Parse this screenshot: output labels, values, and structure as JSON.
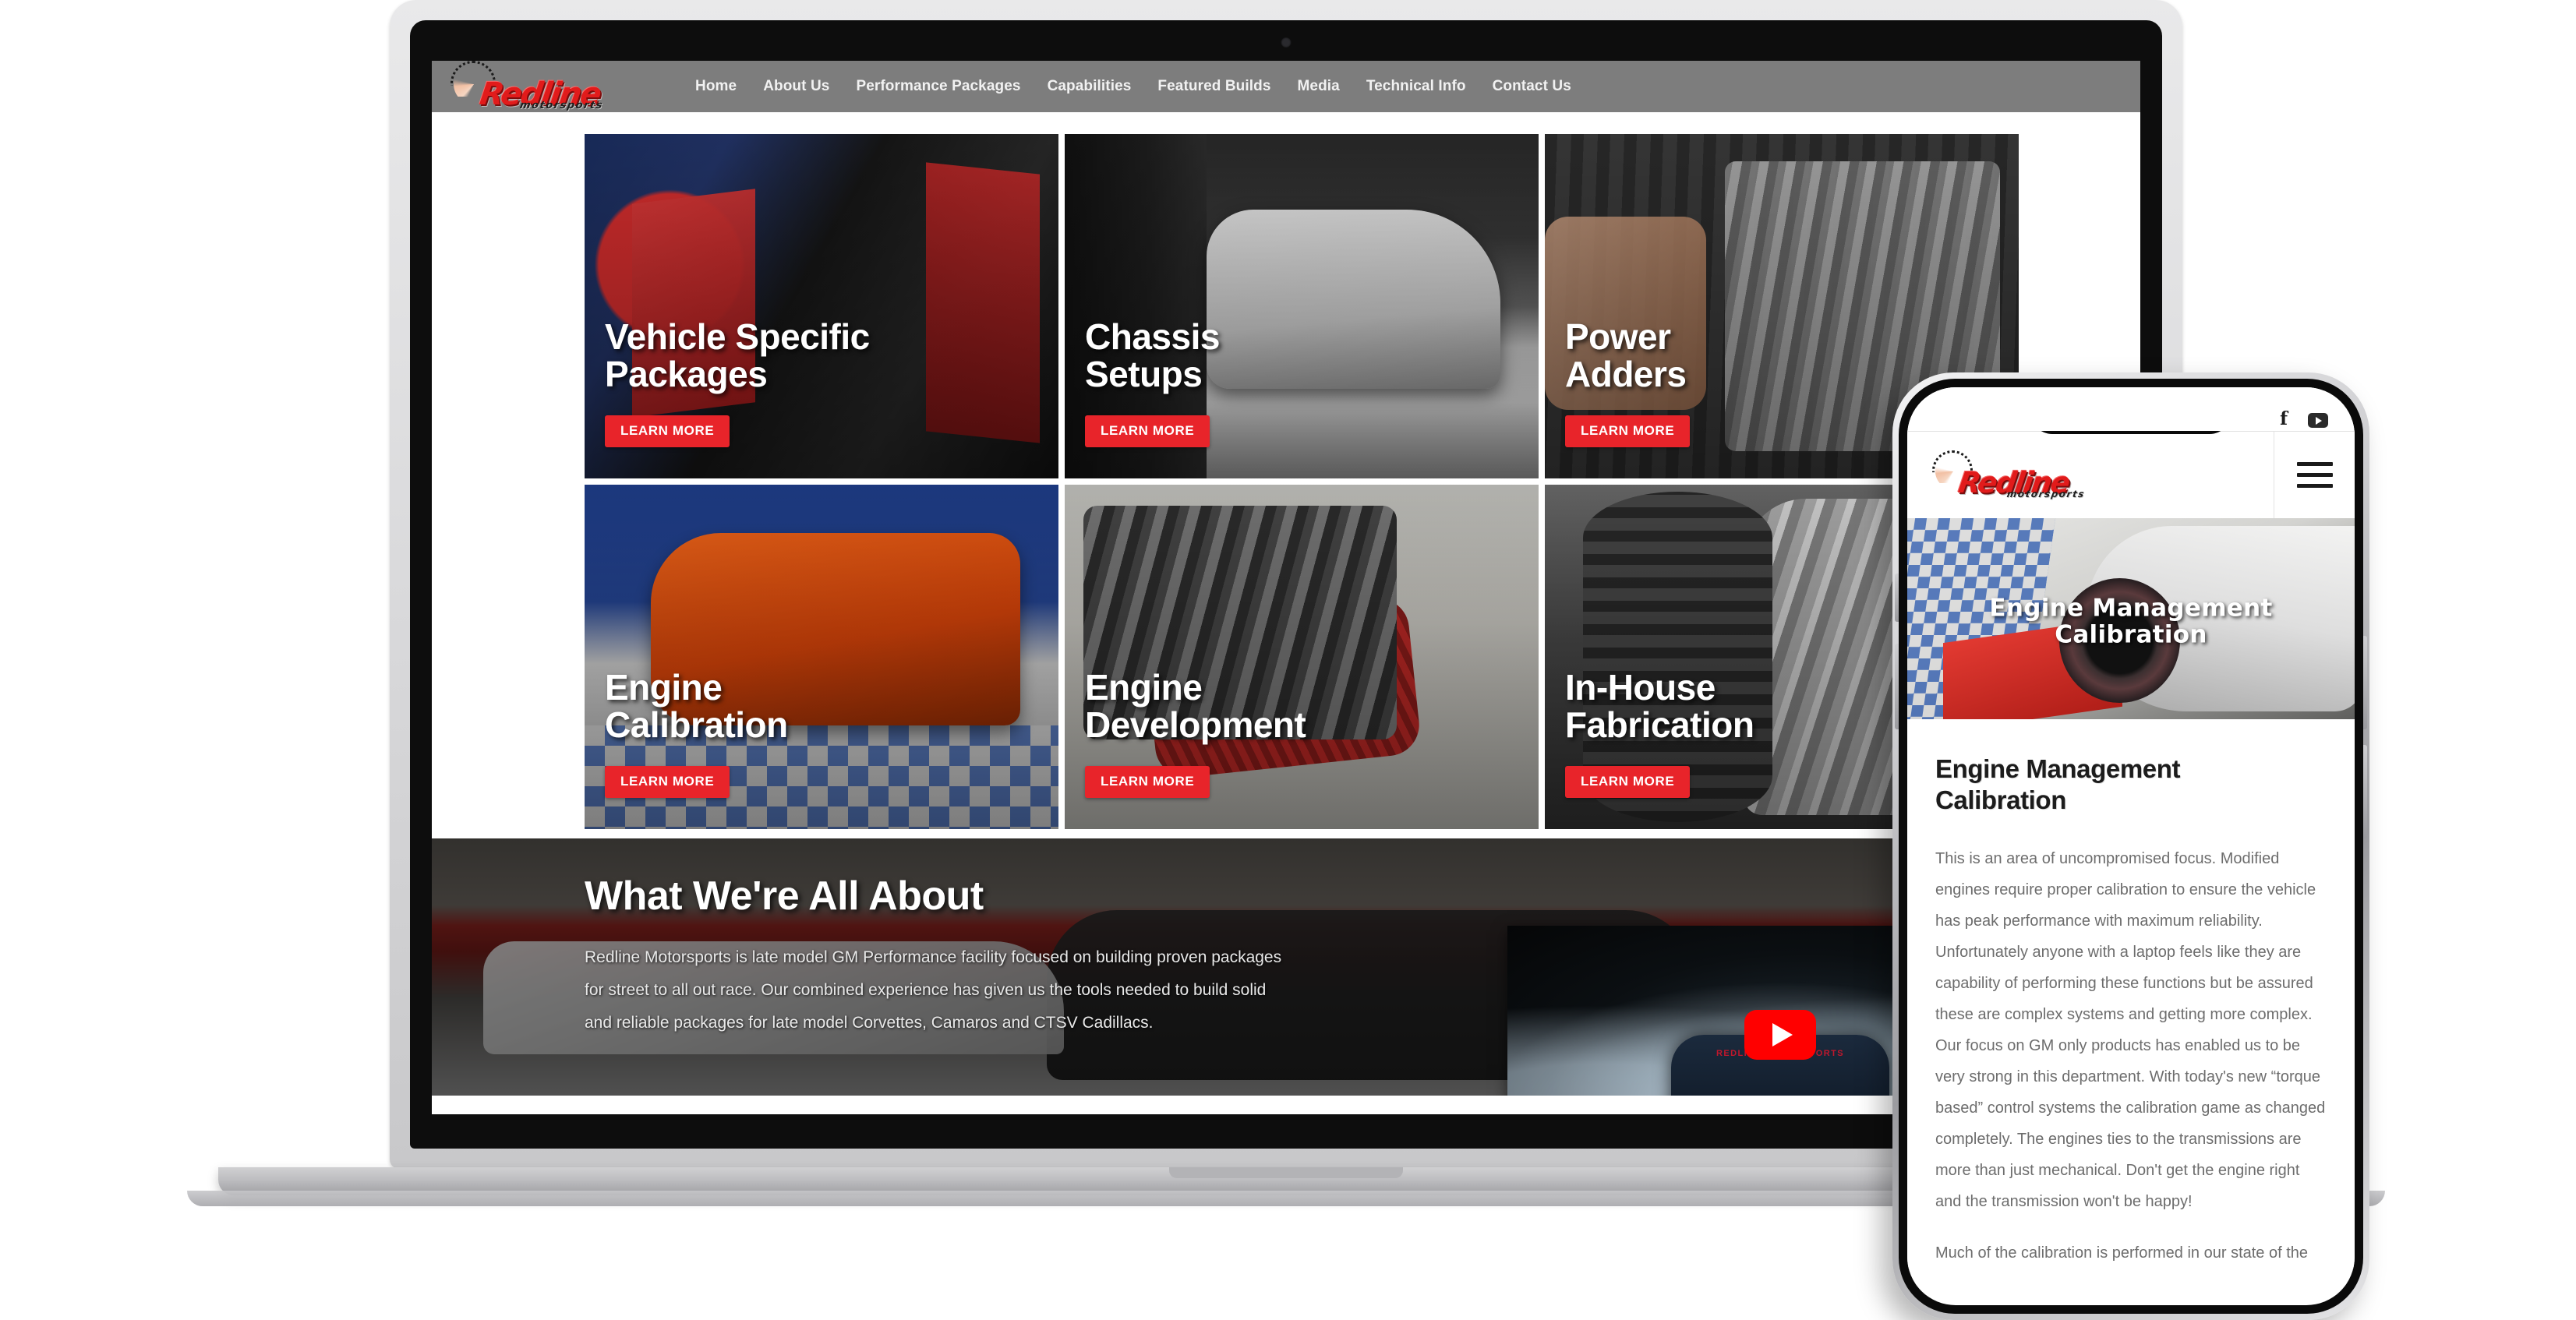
{
  "brand": {
    "name": "Redline",
    "tagline": "motorsports",
    "accent_red": "#e8242a",
    "nav_bar_gray": "#7d7d7d"
  },
  "desktop": {
    "nav": [
      {
        "label": "Home"
      },
      {
        "label": "About Us"
      },
      {
        "label": "Performance Packages"
      },
      {
        "label": "Capabilities"
      },
      {
        "label": "Featured Builds"
      },
      {
        "label": "Media"
      },
      {
        "label": "Technical Info"
      },
      {
        "label": "Contact Us"
      }
    ],
    "tiles": [
      {
        "title": "Vehicle Specific\nPackages",
        "cta": "LEARN MORE"
      },
      {
        "title": "Chassis\nSetups",
        "cta": "LEARN MORE"
      },
      {
        "title": "Power\nAdders",
        "cta": "LEARN MORE"
      },
      {
        "title": "Engine\nCalibration",
        "cta": "LEARN MORE"
      },
      {
        "title": "Engine\nDevelopment",
        "cta": "LEARN MORE"
      },
      {
        "title": "In-House\nFabrication",
        "cta": "LEARN MORE"
      }
    ],
    "about": {
      "title": "What We're All About",
      "body": "Redline Motorsports is  late model GM Performance facility focused on building proven packages for street to all out race. Our combined experience has given us the tools needed to build solid and reliable packages for late model Corvettes, Camaros and CTSV Cadillacs."
    },
    "video": {
      "windshield_banner": "REDLINE MOTORSPORTS"
    }
  },
  "phone": {
    "social": [
      {
        "name": "facebook",
        "glyph": "f"
      },
      {
        "name": "youtube",
        "glyph": ""
      }
    ],
    "hero_title": "Engine Management\nCalibration",
    "page_heading": "Engine Management\nCalibration",
    "paragraphs": [
      "This is an area of uncompromised focus. Modified engines require proper calibration to ensure the vehicle has peak performance with maximum reliability. Unfortunately anyone with a laptop feels like they are capability of performing these functions but be assured these are complex systems and getting more complex. Our focus on GM only products has enabled us to be very strong in this department. With today's new “torque based” control systems the calibration game as changed completely. The engines ties to the transmissions are more than just mechanical. Don't get the engine right and the transmission won't be happy!",
      "Much of the calibration is performed in our state of the"
    ]
  }
}
